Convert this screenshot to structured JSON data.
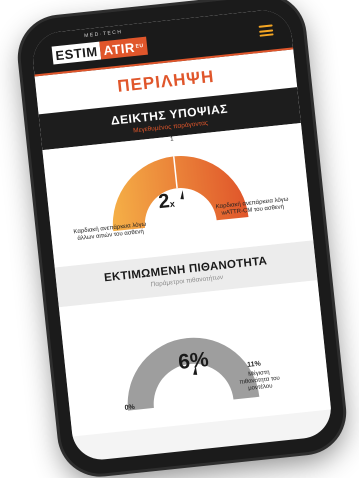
{
  "app": {
    "logo_tagline": "MED·TECH",
    "logo_part1": "ESTIM",
    "logo_part2": "ATIR",
    "logo_suffix": "EU",
    "menu_icon": "hamburger-menu-icon"
  },
  "summary": {
    "title": "ΠΕΡΙΛΗΨΗ"
  },
  "suspicion_index": {
    "title": "ΔΕΙΚΤΗΣ ΥΠΟΨΙΑΣ",
    "subtitle": "Μεγεθυμένος παράγοντας",
    "top_tick": "1",
    "value_label": "2",
    "value_suffix": "x",
    "needle_fraction": 0.55,
    "left_label": "Καρδιακή ανεπάρκεια λόγω άλλων αιτιών του ασθενή",
    "right_label": "Καρδιακή ανεπάρκεια λόγω wATTR-CM του ασθενή",
    "colors": {
      "start": "#f5b047",
      "end": "#e0562b"
    }
  },
  "estimated_probability": {
    "title": "ΕΚΤΙΜΩΜΕΝΗ ΠΙΘΑΝΟΤΗΤΑ",
    "subtitle": "Παράμετροι πιθανοτήτων",
    "value_label": "6%",
    "min_label": "0%",
    "max_label": "11%",
    "max_caption": "Μέγιστη πιθανότητα του μοντέλου",
    "needle_fraction": 0.55,
    "color": "#9e9e9e"
  }
}
